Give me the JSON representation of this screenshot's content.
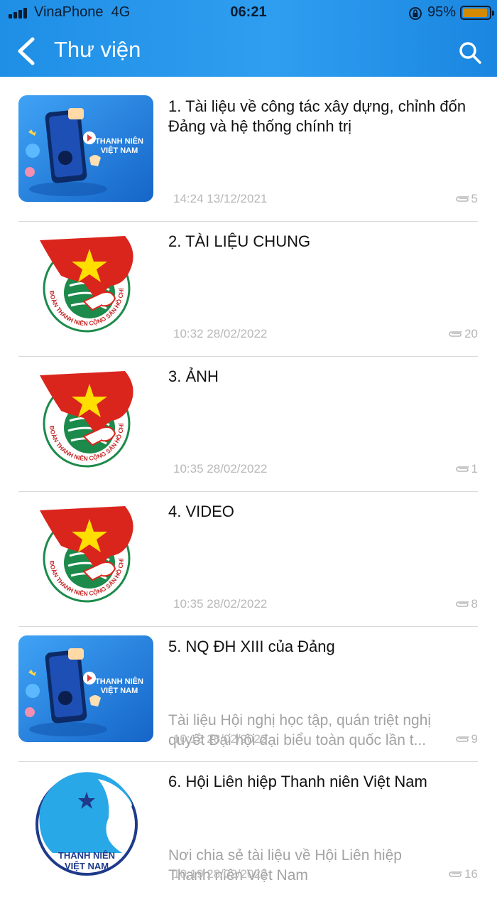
{
  "status_bar": {
    "carrier": "VinaPhone",
    "network": "4G",
    "time": "06:21",
    "battery": "95%",
    "battery_level": 0.95
  },
  "header": {
    "title": "Thư viện",
    "back_icon": "chevron-left-icon",
    "search_icon": "search-icon"
  },
  "colors": {
    "header": "#2196f0",
    "flag_red": "#da251d",
    "star_yellow": "#ffde00",
    "emblem_green": "#1c8a4a",
    "hoi_blue": "#1e3a8a"
  },
  "items": [
    {
      "title": "1. Tài liệu về công tác xây dựng, chỉnh đốn Đảng và hệ thống chính trị",
      "description": [],
      "time": "14:24 13/12/2021",
      "attachments": "5",
      "thumb": "thanh-nien-viet-nam-app",
      "thumb_text": [
        "THANH NIÊN",
        "VIỆT NAM"
      ]
    },
    {
      "title": "2. TÀI LIỆU CHUNG",
      "description": [],
      "time": "10:32 28/02/2022",
      "attachments": "20",
      "thumb": "doan-thanh-nien-emblem",
      "thumb_text": [
        "ĐOÀN THANH NIÊN CỘNG SẢN HỒ CHÍ MINH"
      ]
    },
    {
      "title": "3. ẢNH",
      "description": [],
      "time": "10:35 28/02/2022",
      "attachments": "1",
      "thumb": "doan-thanh-nien-emblem",
      "thumb_text": [
        "ĐOÀN THANH NIÊN CỘNG SẢN HỒ CHÍ MINH"
      ]
    },
    {
      "title": "4. VIDEO",
      "description": [],
      "time": "10:35 28/02/2022",
      "attachments": "8",
      "thumb": "doan-thanh-nien-emblem",
      "thumb_text": [
        "ĐOÀN THANH NIÊN CỘNG SẢN HỒ CHÍ MINH"
      ]
    },
    {
      "title": "5. NQ ĐH XIII của Đảng",
      "description": [
        "Tài liệu Hội nghị học tập, quán triệt nghị",
        "quyết Đại hội đại biểu toàn quốc lần t..."
      ],
      "time": "10:13 28/02/2022",
      "attachments": "9",
      "thumb": "thanh-nien-viet-nam-app",
      "thumb_text": [
        "THANH NIÊN",
        "VIỆT NAM"
      ]
    },
    {
      "title": "6. Hội Liên hiệp Thanh niên Việt Nam",
      "description": [
        "Nơi chia sẻ tài liệu về Hội Liên hiệp",
        "Thanh niên Việt Nam"
      ],
      "time": "10:19 28/02/2022",
      "attachments": "16",
      "thumb": "hoi-lhtn-logo",
      "thumb_text": [
        "THANH NIÊN",
        "VIỆT NAM"
      ]
    }
  ]
}
